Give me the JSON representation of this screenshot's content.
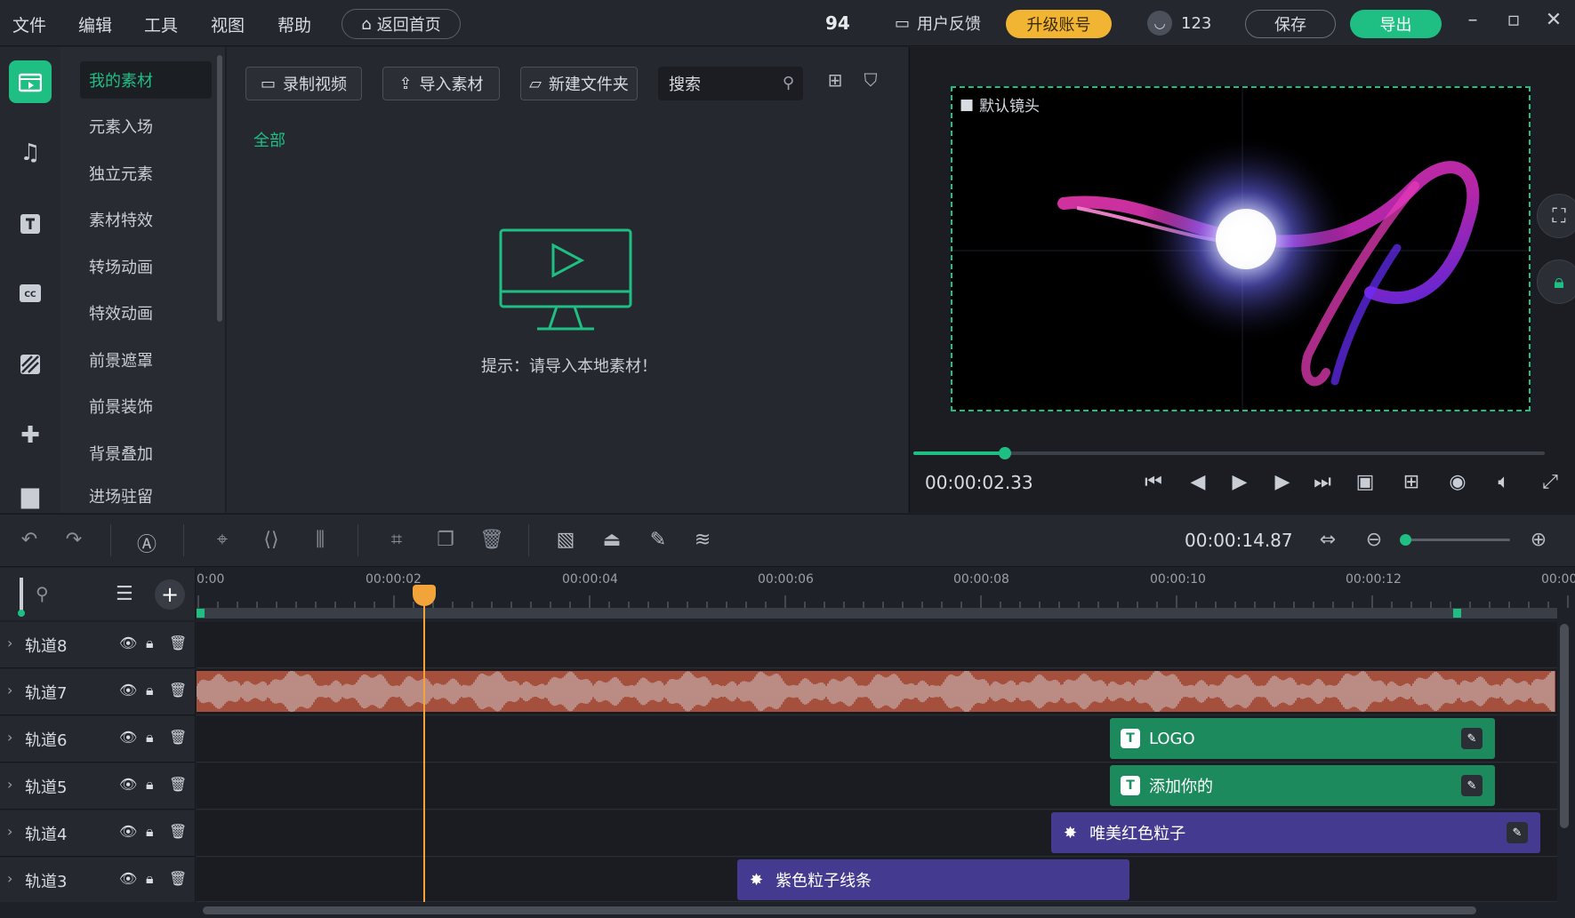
{
  "menu": [
    "文件",
    "编辑",
    "工具",
    "视图",
    "帮助"
  ],
  "header": {
    "home_label": "返回首页",
    "credits": "94",
    "feedback_label": "用户反馈",
    "upgrade_label": "升级账号",
    "user_name": "123",
    "save_label": "保存",
    "export_label": "导出"
  },
  "sidebar": {
    "icons": [
      "media-icon",
      "music-icon",
      "text-icon",
      "subtitle-icon",
      "mask-icon",
      "plugin-icon",
      "folder-icon"
    ]
  },
  "categories": {
    "items": [
      "我的素材",
      "元素入场",
      "独立元素",
      "素材特效",
      "转场动画",
      "特效动画",
      "前景遮罩",
      "前景装饰",
      "背景叠加",
      "进场驻留"
    ],
    "active": "我的素材"
  },
  "materials": {
    "record_label": "录制视频",
    "import_label": "导入素材",
    "new_folder_label": "新建文件夹",
    "search_placeholder": "搜索",
    "tab_all": "全部",
    "empty_hint": "提示：请导入本地素材！"
  },
  "preview": {
    "camera_label": "默认镜头",
    "current_time": "00:00:02.33",
    "progress": 0.145
  },
  "timeline": {
    "total_time": "00:00:14.87",
    "zoom_level": 0.05,
    "ruler_labels": [
      "0:00",
      "00:00:02",
      "00:00:04",
      "00:00:06",
      "00:00:08",
      "00:00:10",
      "00:00:12",
      "00:00"
    ],
    "tracks": [
      {
        "name": "轨道8"
      },
      {
        "name": "轨道7"
      },
      {
        "name": "轨道6"
      },
      {
        "name": "轨道5"
      },
      {
        "name": "轨道4"
      },
      {
        "name": "轨道3"
      }
    ],
    "clips": {
      "logo": "LOGO",
      "add_yours": "添加你的",
      "red_particles": "唯美红色粒子",
      "purple_lines": "紫色粒子线条"
    }
  },
  "colors": {
    "accent": "#1fbf84",
    "upgrade": "#f2b533",
    "playhead": "#f2a33a",
    "audio": "#a4503c",
    "text_clip": "#1d8a5e",
    "effect_clip": "#443a8f"
  }
}
